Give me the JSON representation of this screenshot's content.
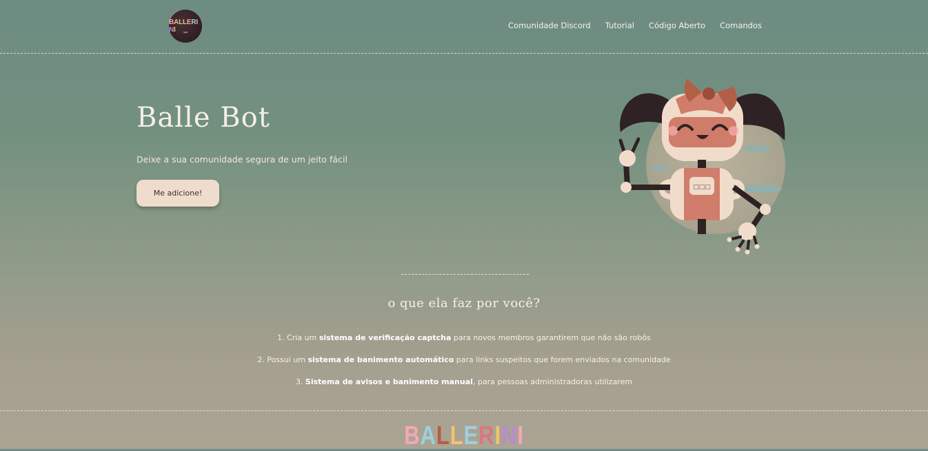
{
  "header": {
    "logo_text": "BALLERINI",
    "logo_subtext": "bot",
    "nav": [
      {
        "label": "Comunidade Discord"
      },
      {
        "label": "Tutorial"
      },
      {
        "label": "Código Aberto"
      },
      {
        "label": "Comandos"
      }
    ]
  },
  "hero": {
    "title": "Balle Bot",
    "subtitle": "Deixe a sua comunidade segura de um jeito fácil",
    "button_label": "Me adicione!",
    "robot_chest_text": "□□□"
  },
  "features": {
    "title": "o que ela faz por você?",
    "items": [
      {
        "prefix": "1. Cria um ",
        "bold": "sistema de verificação captcha",
        "suffix": " para novos membros garantirem que não são robôs"
      },
      {
        "prefix": "2. Possui um ",
        "bold": "sistema de banimento automático",
        "suffix": " para links suspeitos que forem enviados na comunidade"
      },
      {
        "prefix": "3. ",
        "bold": "Sistema de avisos e banimento manual",
        "suffix": ", para pessoas administradoras utilizarem"
      }
    ]
  },
  "footer": {
    "logo_letters": [
      "B",
      "A",
      "L",
      "L",
      "E",
      "R",
      "I",
      "N",
      "I"
    ]
  },
  "colors": {
    "logo_letters": [
      "#f4a7b9",
      "#f6c26b",
      "#9fd3c7",
      "#f6c26b",
      "#f4a7b9",
      "#9fd3c7",
      "#f4a7b9",
      "#b98ad1",
      "#f6c26b"
    ],
    "footer_letters": [
      "#f4a7b9",
      "#9fcfe0",
      "#b85c45",
      "#f6c26b",
      "#9fcfe0",
      "#d9777e",
      "#f6c26b",
      "#b98ad1",
      "#f4a7b9"
    ],
    "accent_button": "#efdccd"
  }
}
